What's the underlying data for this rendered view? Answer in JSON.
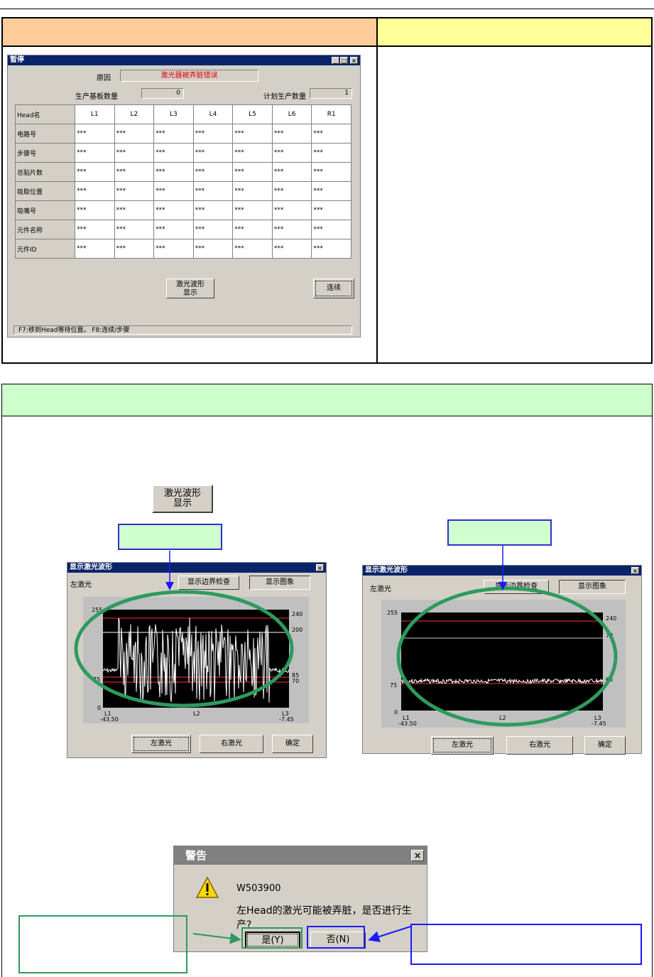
{
  "pause_window": {
    "title": "暂停",
    "reason_label": "原因",
    "reason_value": "激光器被弄脏错误",
    "produced_label": "生产基板数量",
    "produced_value": "0",
    "planned_label": "计划生产数量",
    "planned_value": "1",
    "table": {
      "header_label": "Head名",
      "columns": [
        "L1",
        "L2",
        "L3",
        "L4",
        "L5",
        "L6",
        "R1"
      ],
      "rows": [
        {
          "label": "电路号",
          "values": [
            "***",
            "***",
            "***",
            "***",
            "***",
            "***",
            "***"
          ]
        },
        {
          "label": "步骤号",
          "values": [
            "***",
            "***",
            "***",
            "***",
            "***",
            "***",
            "***"
          ]
        },
        {
          "label": "总贴片数",
          "values": [
            "***",
            "***",
            "***",
            "***",
            "***",
            "***",
            "***"
          ]
        },
        {
          "label": "吸取位置",
          "values": [
            "***",
            "***",
            "***",
            "***",
            "***",
            "***",
            "***"
          ]
        },
        {
          "label": "吸嘴号",
          "values": [
            "***",
            "***",
            "***",
            "***",
            "***",
            "***",
            "***"
          ]
        },
        {
          "label": "元件名称",
          "values": [
            "***",
            "***",
            "***",
            "***",
            "***",
            "***",
            "***"
          ]
        },
        {
          "label": "元件ID",
          "values": [
            "***",
            "***",
            "***",
            "***",
            "***",
            "***",
            "***"
          ]
        }
      ]
    },
    "laser_btn_line1": "激光波形",
    "laser_btn_line2": "显示",
    "continue_btn": "连续",
    "status_bar": "F7:移到Head等待位置。   F8:连续/步骤"
  },
  "laser_button": {
    "line1": "激光波形",
    "line2": "显示"
  },
  "waveform_dirty": {
    "title": "显示激光波形",
    "left_laser_label": "左激光",
    "boundary_btn": "显示边界检查",
    "image_btn": "显示图象",
    "y_left": [
      "255",
      "75",
      "0"
    ],
    "y_right": [
      "240",
      "200",
      "85",
      "70"
    ],
    "x_labels": {
      "l1": "L1",
      "l1_val": "-43.50",
      "l2": "L2",
      "l3": "L3",
      "l3_val": "-7.45"
    },
    "btn_left": "左激光",
    "btn_right": "右激光",
    "btn_ok": "确定"
  },
  "waveform_clean": {
    "title": "显示激光波形",
    "left_laser_label": "左激光",
    "boundary_btn": "显示边界检查",
    "image_btn": "显示图象",
    "y_left": [
      "255",
      "75",
      "0"
    ],
    "y_right": [
      "240",
      "70",
      "65"
    ],
    "x_labels": {
      "l1": "L1",
      "l1_val": "-43.50",
      "l2": "L2",
      "l3": "L3",
      "l3_val": "-7.45"
    },
    "btn_left": "左激光",
    "btn_right": "右激光",
    "btn_ok": "确定"
  },
  "warning_dialog": {
    "title": "警告",
    "code": "W503900",
    "message": "左Head的激光可能被弄脏，是否进行生产?",
    "yes_btn": "是(Y)",
    "no_btn": "否(N)"
  },
  "colors": {
    "header_orange": "#ffcc99",
    "header_yellow": "#ffff99",
    "section_green": "#ccffcc",
    "ellipse_green": "#2e9a5e",
    "arrow_blue": "#1a1aff",
    "arrow_green": "#2e9a5e"
  }
}
